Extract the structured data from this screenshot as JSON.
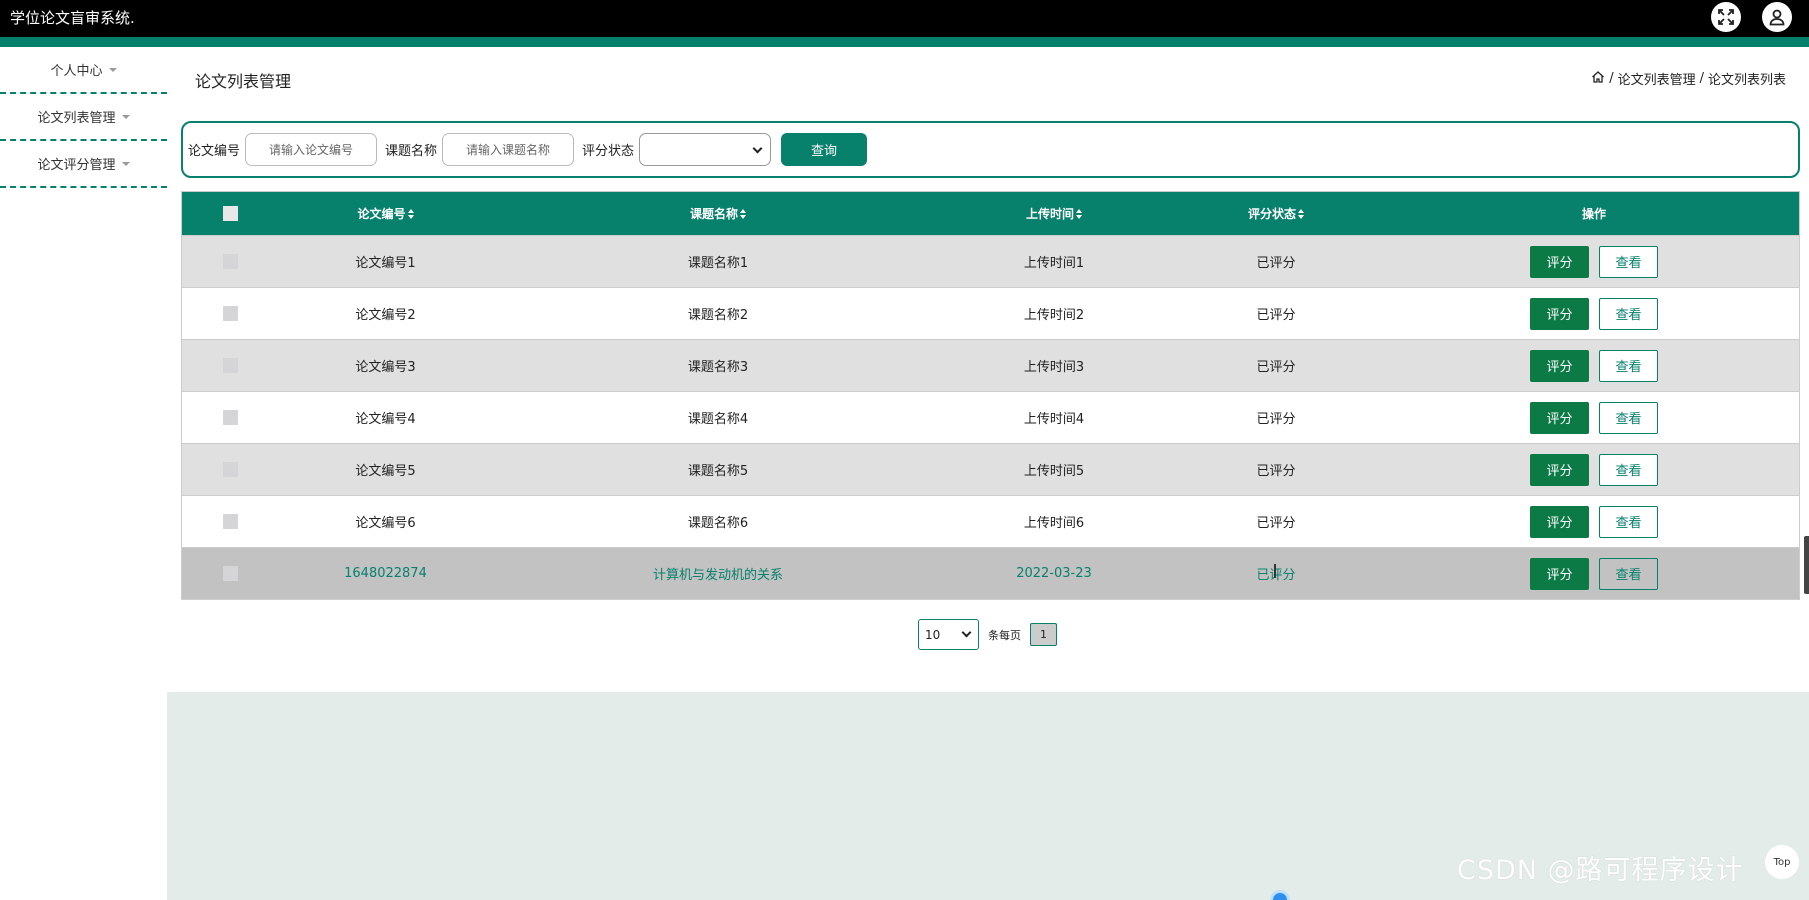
{
  "app": {
    "title": "学位论文盲审系统."
  },
  "header_icons": [
    "fullscreen-icon",
    "user-icon"
  ],
  "sidebar": {
    "items": [
      {
        "label": "个人中心"
      },
      {
        "label": "论文列表管理"
      },
      {
        "label": "论文评分管理"
      }
    ]
  },
  "page": {
    "title": "论文列表管理",
    "breadcrumb": [
      "论文列表管理",
      "论文列表列表"
    ]
  },
  "search": {
    "paper_no_label": "论文编号",
    "paper_no_placeholder": "请输入论文编号",
    "topic_label": "课题名称",
    "topic_placeholder": "请输入课题名称",
    "status_label": "评分状态",
    "status_value": "",
    "query_button": "查询"
  },
  "table": {
    "columns": [
      "论文编号",
      "课题名称",
      "上传时间",
      "评分状态",
      "操作"
    ],
    "rows": [
      {
        "no": "论文编号1",
        "title": "课题名称1",
        "time": "上传时间1",
        "status": "已评分"
      },
      {
        "no": "论文编号2",
        "title": "课题名称2",
        "time": "上传时间2",
        "status": "已评分"
      },
      {
        "no": "论文编号3",
        "title": "课题名称3",
        "time": "上传时间3",
        "status": "已评分"
      },
      {
        "no": "论文编号4",
        "title": "课题名称4",
        "time": "上传时间4",
        "status": "已评分"
      },
      {
        "no": "论文编号5",
        "title": "课题名称5",
        "time": "上传时间5",
        "status": "已评分"
      },
      {
        "no": "论文编号6",
        "title": "课题名称6",
        "time": "上传时间6",
        "status": "已评分"
      },
      {
        "no": "1648022874",
        "title": "计算机与发动机的关系",
        "time": "2022-03-23",
        "status": "已评分"
      }
    ],
    "rate_button": "评分",
    "view_button": "查看"
  },
  "pagination": {
    "page_size": "10",
    "per_page_label": "条每页",
    "current_page": "1"
  },
  "footer": {
    "watermark": "CSDN @路可程序设计",
    "top_button": "Top"
  },
  "colors": {
    "accent": "#07806c",
    "rate_button": "#0b7a44",
    "header_bg": "#000000"
  }
}
